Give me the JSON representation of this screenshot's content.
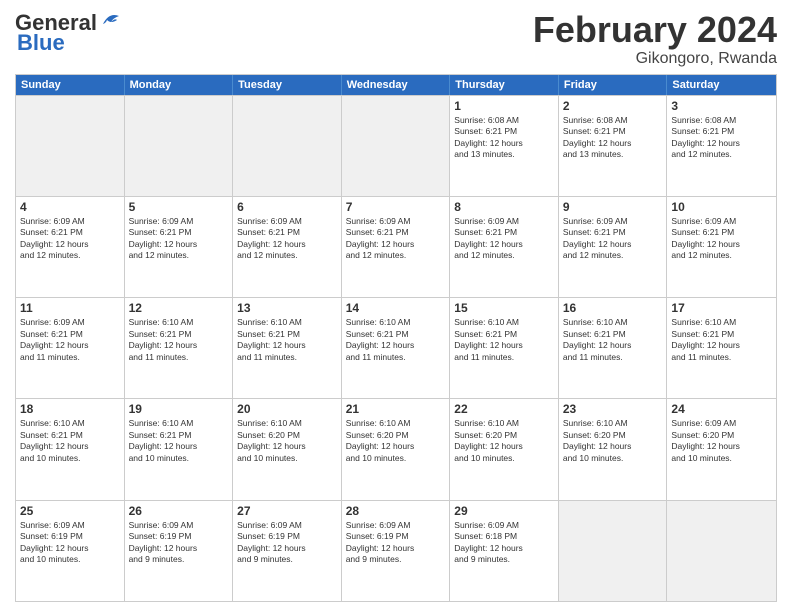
{
  "logo": {
    "line1": "General",
    "line2": "Blue"
  },
  "title": "February 2024",
  "subtitle": "Gikongoro, Rwanda",
  "days": [
    "Sunday",
    "Monday",
    "Tuesday",
    "Wednesday",
    "Thursday",
    "Friday",
    "Saturday"
  ],
  "rows": [
    [
      {
        "day": "",
        "info": "",
        "shaded": true
      },
      {
        "day": "",
        "info": "",
        "shaded": true
      },
      {
        "day": "",
        "info": "",
        "shaded": true
      },
      {
        "day": "",
        "info": "",
        "shaded": true
      },
      {
        "day": "1",
        "info": "Sunrise: 6:08 AM\nSunset: 6:21 PM\nDaylight: 12 hours\nand 13 minutes.",
        "shaded": false
      },
      {
        "day": "2",
        "info": "Sunrise: 6:08 AM\nSunset: 6:21 PM\nDaylight: 12 hours\nand 13 minutes.",
        "shaded": false
      },
      {
        "day": "3",
        "info": "Sunrise: 6:08 AM\nSunset: 6:21 PM\nDaylight: 12 hours\nand 12 minutes.",
        "shaded": false
      }
    ],
    [
      {
        "day": "4",
        "info": "Sunrise: 6:09 AM\nSunset: 6:21 PM\nDaylight: 12 hours\nand 12 minutes.",
        "shaded": false
      },
      {
        "day": "5",
        "info": "Sunrise: 6:09 AM\nSunset: 6:21 PM\nDaylight: 12 hours\nand 12 minutes.",
        "shaded": false
      },
      {
        "day": "6",
        "info": "Sunrise: 6:09 AM\nSunset: 6:21 PM\nDaylight: 12 hours\nand 12 minutes.",
        "shaded": false
      },
      {
        "day": "7",
        "info": "Sunrise: 6:09 AM\nSunset: 6:21 PM\nDaylight: 12 hours\nand 12 minutes.",
        "shaded": false
      },
      {
        "day": "8",
        "info": "Sunrise: 6:09 AM\nSunset: 6:21 PM\nDaylight: 12 hours\nand 12 minutes.",
        "shaded": false
      },
      {
        "day": "9",
        "info": "Sunrise: 6:09 AM\nSunset: 6:21 PM\nDaylight: 12 hours\nand 12 minutes.",
        "shaded": false
      },
      {
        "day": "10",
        "info": "Sunrise: 6:09 AM\nSunset: 6:21 PM\nDaylight: 12 hours\nand 12 minutes.",
        "shaded": false
      }
    ],
    [
      {
        "day": "11",
        "info": "Sunrise: 6:09 AM\nSunset: 6:21 PM\nDaylight: 12 hours\nand 11 minutes.",
        "shaded": false
      },
      {
        "day": "12",
        "info": "Sunrise: 6:10 AM\nSunset: 6:21 PM\nDaylight: 12 hours\nand 11 minutes.",
        "shaded": false
      },
      {
        "day": "13",
        "info": "Sunrise: 6:10 AM\nSunset: 6:21 PM\nDaylight: 12 hours\nand 11 minutes.",
        "shaded": false
      },
      {
        "day": "14",
        "info": "Sunrise: 6:10 AM\nSunset: 6:21 PM\nDaylight: 12 hours\nand 11 minutes.",
        "shaded": false
      },
      {
        "day": "15",
        "info": "Sunrise: 6:10 AM\nSunset: 6:21 PM\nDaylight: 12 hours\nand 11 minutes.",
        "shaded": false
      },
      {
        "day": "16",
        "info": "Sunrise: 6:10 AM\nSunset: 6:21 PM\nDaylight: 12 hours\nand 11 minutes.",
        "shaded": false
      },
      {
        "day": "17",
        "info": "Sunrise: 6:10 AM\nSunset: 6:21 PM\nDaylight: 12 hours\nand 11 minutes.",
        "shaded": false
      }
    ],
    [
      {
        "day": "18",
        "info": "Sunrise: 6:10 AM\nSunset: 6:21 PM\nDaylight: 12 hours\nand 10 minutes.",
        "shaded": false
      },
      {
        "day": "19",
        "info": "Sunrise: 6:10 AM\nSunset: 6:21 PM\nDaylight: 12 hours\nand 10 minutes.",
        "shaded": false
      },
      {
        "day": "20",
        "info": "Sunrise: 6:10 AM\nSunset: 6:20 PM\nDaylight: 12 hours\nand 10 minutes.",
        "shaded": false
      },
      {
        "day": "21",
        "info": "Sunrise: 6:10 AM\nSunset: 6:20 PM\nDaylight: 12 hours\nand 10 minutes.",
        "shaded": false
      },
      {
        "day": "22",
        "info": "Sunrise: 6:10 AM\nSunset: 6:20 PM\nDaylight: 12 hours\nand 10 minutes.",
        "shaded": false
      },
      {
        "day": "23",
        "info": "Sunrise: 6:10 AM\nSunset: 6:20 PM\nDaylight: 12 hours\nand 10 minutes.",
        "shaded": false
      },
      {
        "day": "24",
        "info": "Sunrise: 6:09 AM\nSunset: 6:20 PM\nDaylight: 12 hours\nand 10 minutes.",
        "shaded": false
      }
    ],
    [
      {
        "day": "25",
        "info": "Sunrise: 6:09 AM\nSunset: 6:19 PM\nDaylight: 12 hours\nand 10 minutes.",
        "shaded": false
      },
      {
        "day": "26",
        "info": "Sunrise: 6:09 AM\nSunset: 6:19 PM\nDaylight: 12 hours\nand 9 minutes.",
        "shaded": false
      },
      {
        "day": "27",
        "info": "Sunrise: 6:09 AM\nSunset: 6:19 PM\nDaylight: 12 hours\nand 9 minutes.",
        "shaded": false
      },
      {
        "day": "28",
        "info": "Sunrise: 6:09 AM\nSunset: 6:19 PM\nDaylight: 12 hours\nand 9 minutes.",
        "shaded": false
      },
      {
        "day": "29",
        "info": "Sunrise: 6:09 AM\nSunset: 6:18 PM\nDaylight: 12 hours\nand 9 minutes.",
        "shaded": false
      },
      {
        "day": "",
        "info": "",
        "shaded": true
      },
      {
        "day": "",
        "info": "",
        "shaded": true
      }
    ]
  ]
}
